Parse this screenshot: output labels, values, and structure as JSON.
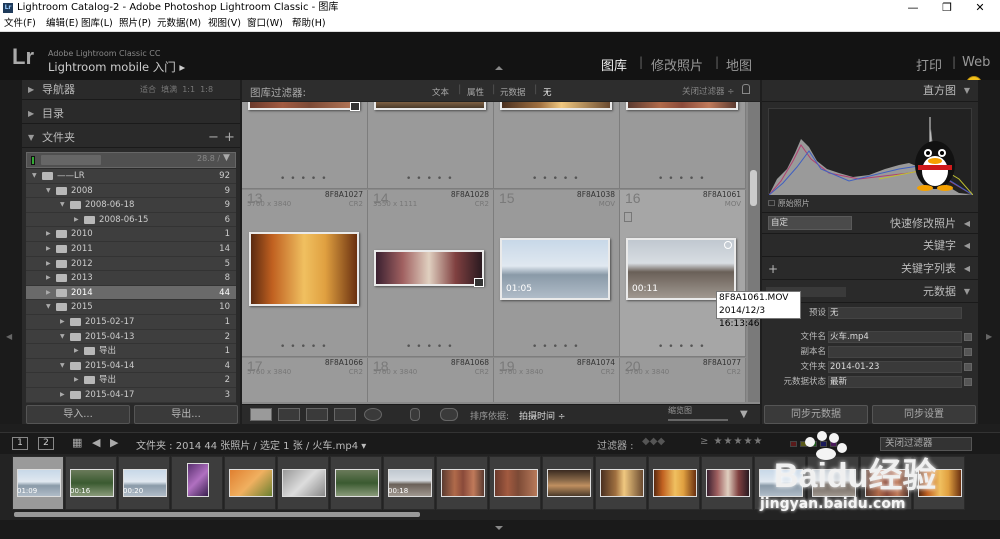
{
  "window": {
    "title": "Lightroom Catalog-2 - Adobe Photoshop Lightroom Classic - 图库",
    "min": "—",
    "max": "❐",
    "close": "✕"
  },
  "menu": [
    "文件(F)",
    "编辑(E)",
    "图库(L)",
    "照片(P)",
    "元数据(M)",
    "视图(V)",
    "窗口(W)",
    "帮助(H)"
  ],
  "identity": {
    "logo": "Lr",
    "line1": "Adobe Lightroom Classic CC",
    "line2": "Lightroom mobile 入门 ▸"
  },
  "modules": [
    {
      "label": "图库",
      "selected": true
    },
    {
      "label": "修改照片",
      "selected": false
    },
    {
      "label": "地图",
      "selected": false
    },
    {
      "label": "打印",
      "selected": false
    },
    {
      "label": "Web",
      "selected": false
    }
  ],
  "ime": {
    "logo": "S"
  },
  "left_panel": {
    "navigator": "导航器",
    "zoom": [
      "适合",
      "填满",
      "1:1",
      "1:8"
    ],
    "catalog": "目录",
    "folders": "文件夹",
    "volume_free": "28.8 / ",
    "tree": [
      {
        "indent": 0,
        "name": "——LR",
        "count": "92",
        "selected": false,
        "open": true
      },
      {
        "indent": 1,
        "name": "2008",
        "count": "9",
        "selected": false,
        "open": true
      },
      {
        "indent": 2,
        "name": "2008-06-18",
        "count": "9",
        "selected": false,
        "open": true
      },
      {
        "indent": 3,
        "name": "2008-06-15",
        "count": "6",
        "selected": false,
        "open": false
      },
      {
        "indent": 1,
        "name": "2010",
        "count": "1",
        "selected": false,
        "open": false
      },
      {
        "indent": 1,
        "name": "2011",
        "count": "14",
        "selected": false,
        "open": false
      },
      {
        "indent": 1,
        "name": "2012",
        "count": "5",
        "selected": false,
        "open": false
      },
      {
        "indent": 1,
        "name": "2013",
        "count": "8",
        "selected": false,
        "open": false
      },
      {
        "indent": 1,
        "name": "2014",
        "count": "44",
        "selected": true,
        "open": false
      },
      {
        "indent": 1,
        "name": "2015",
        "count": "10",
        "selected": false,
        "open": true
      },
      {
        "indent": 2,
        "name": "2015-02-17",
        "count": "1",
        "selected": false,
        "open": false
      },
      {
        "indent": 2,
        "name": "2015-04-13",
        "count": "2",
        "selected": false,
        "open": true
      },
      {
        "indent": 3,
        "name": "导出",
        "count": "1",
        "selected": false,
        "open": false
      },
      {
        "indent": 2,
        "name": "2015-04-14",
        "count": "4",
        "selected": false,
        "open": true
      },
      {
        "indent": 3,
        "name": "导出",
        "count": "2",
        "selected": false,
        "open": false
      },
      {
        "indent": 2,
        "name": "2015-04-17",
        "count": "3",
        "selected": false,
        "open": false
      }
    ],
    "import": "导入...",
    "export": "导出..."
  },
  "filter_bar": {
    "label": "图库过滤器:",
    "options": [
      "文本",
      "属性",
      "元数据",
      "无"
    ],
    "dropdown": "关闭过滤器 ÷"
  },
  "grid": {
    "rows": [
      [
        {
          "num": "",
          "name": "",
          "dims": "",
          "type": "",
          "thumb": "t-brick",
          "badge": true,
          "video": ""
        },
        {
          "num": "",
          "name": "",
          "dims": "",
          "type": "",
          "thumb": "t-hall",
          "badge": false,
          "video": ""
        },
        {
          "num": "",
          "name": "",
          "dims": "",
          "type": "",
          "thumb": "t-shop",
          "badge": false,
          "video": ""
        },
        {
          "num": "",
          "name": "",
          "dims": "",
          "type": "",
          "thumb": "t-col",
          "badge": false,
          "video": ""
        }
      ],
      [
        {
          "num": "13",
          "name": "8F8A1027",
          "dims": "5760 x 3840",
          "type": "CR2",
          "thumb": "t-gold",
          "badge": false,
          "video": ""
        },
        {
          "num": "14",
          "name": "8F8A1028",
          "dims": "3550 x 1111",
          "type": "CR2",
          "thumb": "t-pano",
          "badge": true,
          "video": ""
        },
        {
          "num": "15",
          "name": "8F8A1038",
          "dims": "",
          "type": "MOV",
          "thumb": "t-river",
          "badge": false,
          "video": "01:05"
        },
        {
          "num": "16",
          "name": "8F8A1061",
          "dims": "",
          "type": "MOV",
          "thumb": "t-street",
          "badge": false,
          "video": "00:11"
        }
      ],
      [
        {
          "num": "17",
          "name": "8F8A1066",
          "dims": "5760 x 3840",
          "type": "CR2",
          "thumb": "",
          "badge": false,
          "video": ""
        },
        {
          "num": "18",
          "name": "8F8A1068",
          "dims": "5760 x 3840",
          "type": "CR2",
          "thumb": "",
          "badge": false,
          "video": ""
        },
        {
          "num": "19",
          "name": "8F8A1074",
          "dims": "5760 x 3840",
          "type": "CR2",
          "thumb": "",
          "badge": false,
          "video": ""
        },
        {
          "num": "20",
          "name": "8F8A1077",
          "dims": "5760 x 3840",
          "type": "CR2",
          "thumb": "",
          "badge": false,
          "video": ""
        }
      ]
    ]
  },
  "tooltip": {
    "line1": "8F8A1061.MOV",
    "line2": "2014/12/3 16:13:46"
  },
  "toolbar": {
    "sort_label": "排序依据:",
    "sort_value": "拍摄时间 ÷",
    "thumb_label": "缩览图"
  },
  "right_panel": {
    "histogram": "直方图",
    "original": "原始照片",
    "custom": "自定",
    "quick_develop": "快速修改照片",
    "keywords": "关键字",
    "keyword_list": "关键字列表",
    "metadata": "元数据",
    "preset_key": "预设",
    "preset_value": "无",
    "fields": [
      {
        "key": "文件名",
        "value": "火车.mp4"
      },
      {
        "key": "副本名",
        "value": ""
      },
      {
        "key": "文件夹",
        "value": "2014-01-23"
      },
      {
        "key": "元数据状态",
        "value": "最新"
      }
    ],
    "sync_metadata": "同步元数据",
    "sync_settings": "同步设置"
  },
  "status": {
    "page1": "1",
    "page2": "2",
    "path": "文件夹 : 2014   44 张照片 / 选定 1 张 / 火车.mp4 ▾",
    "filter_label": "过滤器 :",
    "stars": "≥ ★★★★★",
    "close_filter": "关闭过滤器"
  },
  "filmstrip": [
    {
      "thumb": "t-river",
      "video": "01:09",
      "sel": true
    },
    {
      "thumb": "t-tree",
      "video": "00:16",
      "sel": false
    },
    {
      "thumb": "t-river",
      "video": "00:20",
      "sel": false
    },
    {
      "thumb": "t-purple",
      "video": "",
      "sel": false
    },
    {
      "thumb": "t-cat",
      "video": "",
      "sel": false
    },
    {
      "thumb": "t-gray",
      "video": "",
      "sel": false
    },
    {
      "thumb": "t-tree",
      "video": "",
      "sel": false
    },
    {
      "thumb": "t-street",
      "video": "00:18",
      "sel": false
    },
    {
      "thumb": "t-col",
      "video": "",
      "sel": false
    },
    {
      "thumb": "t-brick",
      "video": "",
      "sel": false
    },
    {
      "thumb": "t-hall",
      "video": "",
      "sel": false
    },
    {
      "thumb": "t-shop",
      "video": "",
      "sel": false
    },
    {
      "thumb": "t-gold",
      "video": "",
      "sel": false
    },
    {
      "thumb": "t-pano",
      "video": "",
      "sel": false
    },
    {
      "thumb": "t-river",
      "video": "",
      "sel": false
    },
    {
      "thumb": "t-street",
      "video": "",
      "sel": false
    },
    {
      "thumb": "t-col",
      "video": "",
      "sel": false
    },
    {
      "thumb": "t-gold",
      "video": "",
      "sel": false
    }
  ],
  "watermark": {
    "brand": "Baidu经验",
    "url": "jingyan.baidu.com"
  }
}
